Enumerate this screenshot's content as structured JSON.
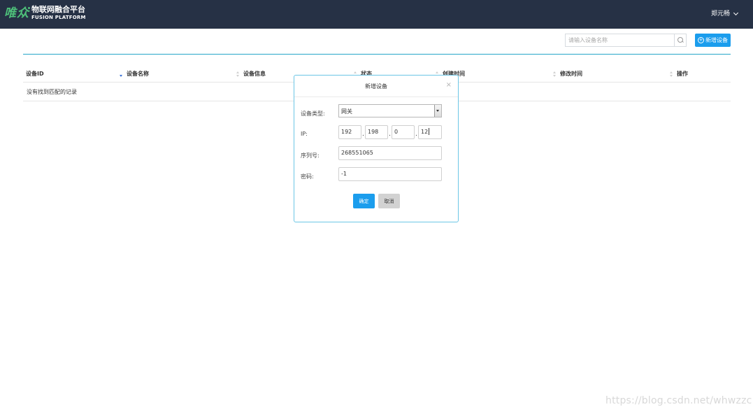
{
  "header": {
    "logo_text": "唯众",
    "platform_title": "物联网融合平台",
    "platform_subtitle": "FUSION PLATFORM",
    "user_name": "郑元畅"
  },
  "toolbar": {
    "search_placeholder": "请输入设备名称",
    "search_value": "",
    "add_label": "新增设备"
  },
  "table": {
    "columns": [
      "设备ID",
      "设备名称",
      "设备信息",
      "状态",
      "创建时间",
      "修改时间",
      "操作"
    ],
    "empty_message": "没有找到匹配的记录"
  },
  "modal": {
    "title": "新增设备",
    "close": "×",
    "type_label": "设备类型:",
    "type_value": "网关",
    "ip_label": "IP:",
    "ip_parts": [
      "192",
      "198",
      "0",
      "12"
    ],
    "ip_separator": ".",
    "serial_label": "序列号:",
    "serial_value": "268551065",
    "password_label": "密码:",
    "password_value": "-1",
    "confirm_label": "确定",
    "cancel_label": "取消"
  },
  "watermark": "https://blog.csdn.net/whwzzc",
  "colors": {
    "topbar": "#263145",
    "primary": "#1b9ded",
    "accent_line": "#25a5c8",
    "logo_green": "#4ec07a"
  }
}
